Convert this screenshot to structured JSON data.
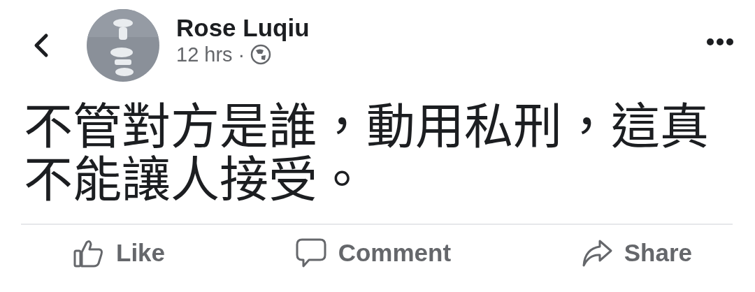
{
  "header": {
    "author": "Rose Luqiu",
    "time": "12 hrs",
    "separator": "·"
  },
  "post": {
    "text": "不管對方是誰，動用私刑，這真不能讓人接受。"
  },
  "actions": [
    {
      "kind": "like",
      "label": "Like"
    },
    {
      "kind": "comment",
      "label": "Comment"
    },
    {
      "kind": "share",
      "label": "Share"
    }
  ]
}
